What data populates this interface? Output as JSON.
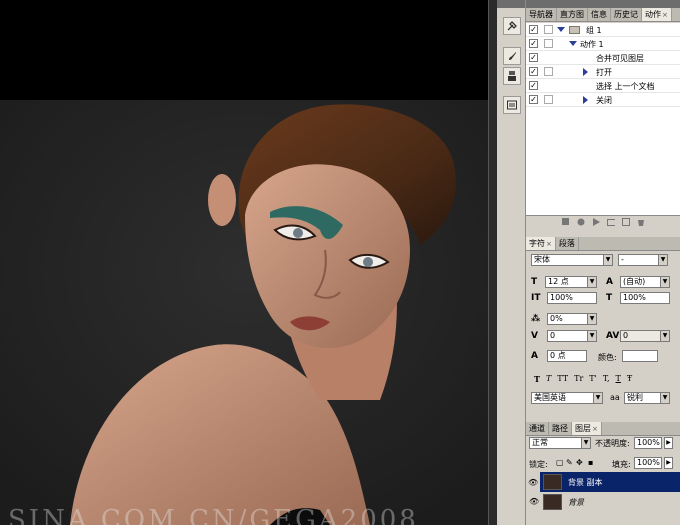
{
  "canvas": {
    "watermark_text": "SINA.COM.CN/GEGA2008"
  },
  "actions_panel": {
    "tabs": [
      {
        "label": "导航器",
        "active": false
      },
      {
        "label": "直方图",
        "active": false
      },
      {
        "label": "信息",
        "active": false
      },
      {
        "label": "历史记",
        "active": false
      },
      {
        "label": "动作",
        "active": true
      }
    ],
    "rows": [
      {
        "label": "组 1",
        "checked": true,
        "kind": "set",
        "expanded": true
      },
      {
        "label": "动作 1",
        "checked": true,
        "kind": "action",
        "expanded": true
      },
      {
        "label": "合并可见图层",
        "checked": true,
        "kind": "step"
      },
      {
        "label": "打开",
        "checked": true,
        "kind": "step",
        "has_arrow": true
      },
      {
        "label": "选择 上一个文档",
        "checked": true,
        "kind": "step"
      },
      {
        "label": "关闭",
        "checked": true,
        "kind": "step",
        "has_arrow": true
      }
    ]
  },
  "character_panel": {
    "tabs": [
      {
        "label": "字符",
        "active": true
      },
      {
        "label": "段落",
        "active": false
      }
    ],
    "font_family": "宋体",
    "font_style": "-",
    "font_size": "12 点",
    "leading": "(自动)",
    "vertical_scale": "100%",
    "horizontal_scale": "100%",
    "tsume": "0%",
    "kerning": "0",
    "tracking": "0",
    "baseline_shift": "0 点",
    "color_label": "颜色:",
    "type_buttons": [
      "T",
      "T",
      "TT",
      "Tr",
      "T'",
      "T,",
      "T",
      "Ŧ"
    ],
    "language": "美国英语",
    "aa_label": "aa",
    "antialias": "锐利"
  },
  "layers_panel": {
    "tabs": [
      {
        "label": "通道",
        "active": false
      },
      {
        "label": "路径",
        "active": false
      },
      {
        "label": "图层",
        "active": true
      }
    ],
    "blend_mode": "正常",
    "opacity_label": "不透明度:",
    "opacity_value": "100%",
    "lock_label": "锁定:",
    "fill_label": "填充:",
    "fill_value": "100%",
    "layers": [
      {
        "name": "背景 副本",
        "selected": true
      },
      {
        "name": "背景",
        "selected": false
      }
    ]
  },
  "colors": {
    "panel_bg": "#d4d0c8",
    "selection": "#0a246a",
    "action_triangle": "#2a3e9a"
  }
}
